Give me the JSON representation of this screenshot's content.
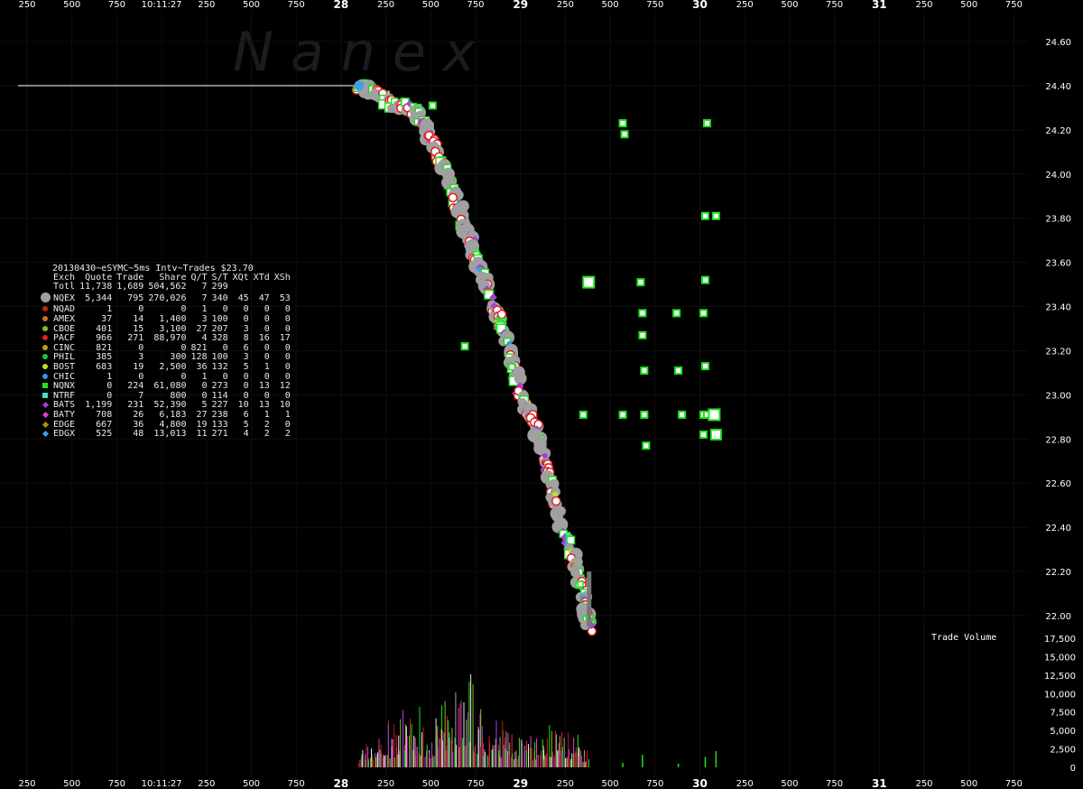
{
  "watermark": "Nanex",
  "header": {
    "title": "20130430~eSYMC~5ms Intv~Trades $23.70",
    "columns": [
      "Exch",
      "Quote",
      "Trade",
      "Share",
      "Q/T",
      "S/T",
      "XQt",
      "XTd",
      "XSh"
    ],
    "total": {
      "exch": "Totl",
      "quote": "11,738",
      "trade": "1,689",
      "share": "504,562",
      "qt": "7",
      "st": "299",
      "xqt": "",
      "xtd": "",
      "xsh": ""
    }
  },
  "exchanges": [
    {
      "exch": "NQEX",
      "quote": "5,344",
      "trade": "795",
      "share": "270,026",
      "qt": "7",
      "st": "340",
      "xqt": "45",
      "xtd": "47",
      "xsh": "53",
      "color": "#a0a0a0",
      "marker": "big-dot"
    },
    {
      "exch": "NQAD",
      "quote": "1",
      "trade": "0",
      "share": "0",
      "qt": "1",
      "st": "0",
      "xqt": "0",
      "xtd": "0",
      "xsh": "0",
      "color": "#c02020",
      "marker": "dot"
    },
    {
      "exch": "AMEX",
      "quote": "37",
      "trade": "14",
      "share": "1,400",
      "qt": "3",
      "st": "100",
      "xqt": "0",
      "xtd": "0",
      "xsh": "0",
      "color": "#d07020",
      "marker": "dot"
    },
    {
      "exch": "CBOE",
      "quote": "401",
      "trade": "15",
      "share": "3,100",
      "qt": "27",
      "st": "207",
      "xqt": "3",
      "xtd": "0",
      "xsh": "0",
      "color": "#80c020",
      "marker": "dot"
    },
    {
      "exch": "PACF",
      "quote": "966",
      "trade": "271",
      "share": "88,970",
      "qt": "4",
      "st": "328",
      "xqt": "8",
      "xtd": "16",
      "xsh": "17",
      "color": "#e02020",
      "marker": "dot"
    },
    {
      "exch": "CINC",
      "quote": "821",
      "trade": "0",
      "share": "0",
      "qt": "821",
      "st": "0",
      "xqt": "6",
      "xtd": "0",
      "xsh": "0",
      "color": "#c0a000",
      "marker": "dot"
    },
    {
      "exch": "PHIL",
      "quote": "385",
      "trade": "3",
      "share": "300",
      "qt": "128",
      "st": "100",
      "xqt": "3",
      "xtd": "0",
      "xsh": "0",
      "color": "#20c040",
      "marker": "dot"
    },
    {
      "exch": "BOST",
      "quote": "683",
      "trade": "19",
      "share": "2,500",
      "qt": "36",
      "st": "132",
      "xqt": "5",
      "xtd": "1",
      "xsh": "0",
      "color": "#c0e020",
      "marker": "dot"
    },
    {
      "exch": "CHIC",
      "quote": "1",
      "trade": "0",
      "share": "0",
      "qt": "1",
      "st": "0",
      "xqt": "0",
      "xtd": "0",
      "xsh": "0",
      "color": "#4090e0",
      "marker": "dot"
    },
    {
      "exch": "NQNX",
      "quote": "0",
      "trade": "224",
      "share": "61,080",
      "qt": "0",
      "st": "273",
      "xqt": "0",
      "xtd": "13",
      "xsh": "12",
      "color": "#20e020",
      "marker": "square"
    },
    {
      "exch": "NTRF",
      "quote": "0",
      "trade": "7",
      "share": "800",
      "qt": "0",
      "st": "114",
      "xqt": "0",
      "xtd": "0",
      "xsh": "0",
      "color": "#40e0c0",
      "marker": "square"
    },
    {
      "exch": "BATS",
      "quote": "1,199",
      "trade": "231",
      "share": "52,390",
      "qt": "5",
      "st": "227",
      "xqt": "10",
      "xtd": "13",
      "xsh": "10",
      "color": "#a040e0",
      "marker": "diamond"
    },
    {
      "exch": "BATY",
      "quote": "708",
      "trade": "26",
      "share": "6,183",
      "qt": "27",
      "st": "238",
      "xqt": "6",
      "xtd": "1",
      "xsh": "1",
      "color": "#e040c0",
      "marker": "diamond"
    },
    {
      "exch": "EDGE",
      "quote": "667",
      "trade": "36",
      "share": "4,800",
      "qt": "19",
      "st": "133",
      "xqt": "5",
      "xtd": "2",
      "xsh": "0",
      "color": "#b09000",
      "marker": "diamond"
    },
    {
      "exch": "EDGX",
      "quote": "525",
      "trade": "48",
      "share": "13,013",
      "qt": "11",
      "st": "271",
      "xqt": "4",
      "xtd": "2",
      "xsh": "2",
      "color": "#40a0e0",
      "marker": "diamond"
    }
  ],
  "volume_label": "Trade Volume",
  "chart_data": {
    "type": "scatter",
    "x_ticks": [
      "250",
      "500",
      "750",
      "10:11:27",
      "250",
      "500",
      "750",
      "28",
      "250",
      "500",
      "750",
      "29",
      "250",
      "500",
      "750",
      "30",
      "250",
      "500",
      "750",
      "31",
      "250",
      "500",
      "750"
    ],
    "x_ticks_bold": [
      "28",
      "29",
      "30",
      "31"
    ],
    "x_tick_time": "10:11:27",
    "price_ticks": [
      "24.60",
      "24.40",
      "24.20",
      "24.00",
      "23.80",
      "23.60",
      "23.40",
      "23.20",
      "23.00",
      "22.80",
      "22.60",
      "22.40",
      "22.20",
      "22.00"
    ],
    "price_ylim": [
      21.9,
      24.66
    ],
    "volume_ticks": [
      "17,500",
      "15,000",
      "12,500",
      "10,000",
      "7,500",
      "5,000",
      "2,500",
      "0"
    ],
    "volume_ylim": [
      0,
      17500
    ],
    "x_range_seconds": [
      27.0,
      31.75
    ],
    "prior_price": 24.4,
    "price_path": [
      [
        28.1,
        24.4
      ],
      [
        28.2,
        24.36
      ],
      [
        28.3,
        24.32
      ],
      [
        28.4,
        24.3
      ],
      [
        28.45,
        24.24
      ],
      [
        28.5,
        24.16
      ],
      [
        28.55,
        24.06
      ],
      [
        28.6,
        23.96
      ],
      [
        28.65,
        23.86
      ],
      [
        28.7,
        23.74
      ],
      [
        28.75,
        23.62
      ],
      [
        28.8,
        23.52
      ],
      [
        28.85,
        23.4
      ],
      [
        28.9,
        23.3
      ],
      [
        28.95,
        23.15
      ],
      [
        29.0,
        23.0
      ],
      [
        29.05,
        22.92
      ],
      [
        29.1,
        22.8
      ],
      [
        29.15,
        22.66
      ],
      [
        29.2,
        22.5
      ],
      [
        29.25,
        22.36
      ],
      [
        29.3,
        22.24
      ],
      [
        29.35,
        22.12
      ],
      [
        29.37,
        22.0
      ],
      [
        29.38,
        21.95
      ]
    ],
    "late_trades": [
      [
        28.51,
        24.31
      ],
      [
        28.69,
        23.22
      ],
      [
        29.38,
        23.51
      ],
      [
        29.35,
        22.91
      ],
      [
        29.57,
        24.23
      ],
      [
        29.58,
        24.18
      ],
      [
        29.57,
        22.91
      ],
      [
        29.67,
        23.51
      ],
      [
        29.68,
        23.37
      ],
      [
        29.68,
        23.27
      ],
      [
        29.69,
        23.11
      ],
      [
        29.69,
        22.91
      ],
      [
        29.7,
        22.77
      ],
      [
        29.87,
        23.37
      ],
      [
        29.88,
        23.11
      ],
      [
        29.9,
        22.91
      ],
      [
        30.03,
        23.81
      ],
      [
        30.03,
        23.52
      ],
      [
        30.02,
        23.37
      ],
      [
        30.03,
        23.13
      ],
      [
        30.02,
        22.91
      ],
      [
        30.04,
        22.91
      ],
      [
        30.02,
        22.82
      ],
      [
        30.04,
        24.23
      ],
      [
        30.09,
        23.81
      ],
      [
        30.08,
        22.91
      ],
      [
        30.09,
        22.82
      ]
    ],
    "volume_path": [
      [
        28.1,
        3500
      ],
      [
        28.2,
        6000
      ],
      [
        28.3,
        9000
      ],
      [
        28.4,
        11000
      ],
      [
        28.5,
        7000
      ],
      [
        28.6,
        13500
      ],
      [
        28.7,
        15300
      ],
      [
        28.8,
        9500
      ],
      [
        28.9,
        8500
      ],
      [
        29.0,
        6000
      ],
      [
        29.1,
        5500
      ],
      [
        29.2,
        8500
      ],
      [
        29.3,
        6500
      ],
      [
        29.38,
        3000
      ]
    ],
    "late_volume": [
      [
        29.57,
        600
      ],
      [
        29.68,
        1700
      ],
      [
        29.88,
        500
      ],
      [
        30.03,
        1400
      ],
      [
        30.09,
        2200
      ]
    ]
  }
}
